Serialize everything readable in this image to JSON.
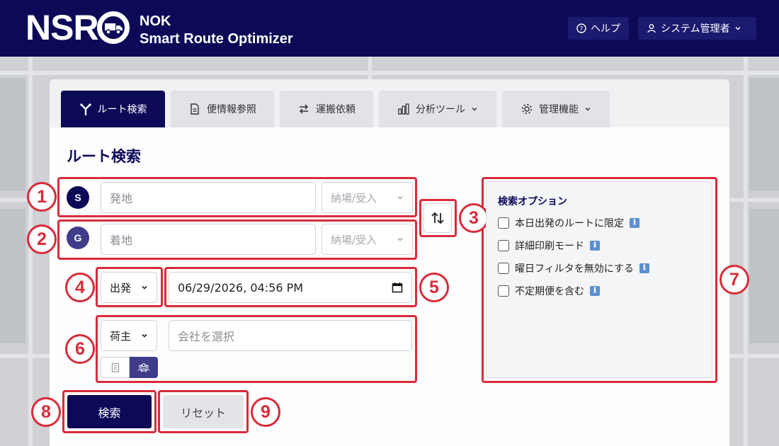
{
  "brand": {
    "logo_text": "NSR",
    "company": "NOK",
    "product": "Smart Route Optimizer"
  },
  "header": {
    "help_label": "ヘルプ",
    "user_label": "システム管理者"
  },
  "tabs": [
    {
      "label": "ルート検索",
      "icon": "route-icon"
    },
    {
      "label": "便情報参照",
      "icon": "document-icon"
    },
    {
      "label": "運搬依頼",
      "icon": "swap-arrows-icon"
    },
    {
      "label": "分析ツール",
      "icon": "bar-chart-icon"
    },
    {
      "label": "管理機能",
      "icon": "gear-icon"
    }
  ],
  "page_title": "ルート検索",
  "origin": {
    "badge": "S",
    "placeholder": "発地",
    "type_select": "納場/受入"
  },
  "destination": {
    "badge": "G",
    "placeholder": "着地",
    "type_select": "納場/受入"
  },
  "time_mode": {
    "value": "出発"
  },
  "datetime": {
    "value": "06/29/2026, 04:56 PM"
  },
  "company": {
    "role_select": "荷主",
    "placeholder": "会社を選択"
  },
  "options": {
    "title": "検索オプション",
    "items": [
      {
        "label": "本日出発のルートに限定",
        "checked": false
      },
      {
        "label": "詳細印刷モード",
        "checked": false
      },
      {
        "label": "曜日フィルタを無効にする",
        "checked": false
      },
      {
        "label": "不定期便を含む",
        "checked": false
      }
    ],
    "info_glyph": "ℹ"
  },
  "actions": {
    "search_label": "検索",
    "reset_label": "リセット"
  },
  "annotations": [
    "1",
    "2",
    "3",
    "4",
    "5",
    "6",
    "7",
    "8",
    "9"
  ],
  "colors": {
    "primary": "#0c0a57",
    "annotation": "#d92b3a",
    "goal_badge": "#3f3d8a"
  }
}
